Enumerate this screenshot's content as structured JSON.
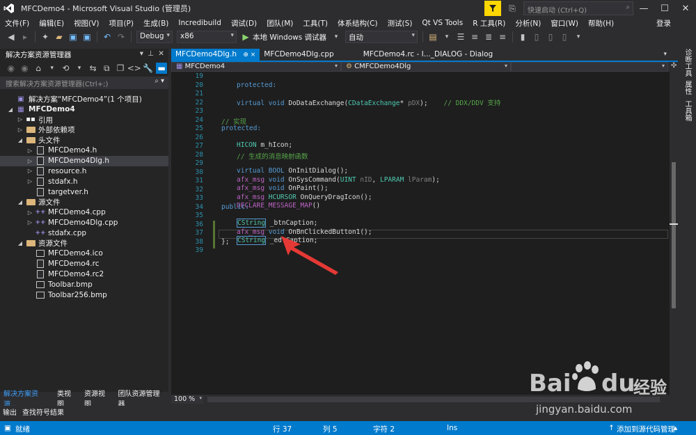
{
  "window": {
    "title": "MFCDemo4 - Microsoft Visual Studio (管理员)",
    "quick_launch_placeholder": "快速启动 (Ctrl+Q)"
  },
  "menu": {
    "items": [
      "文件(F)",
      "编辑(E)",
      "视图(V)",
      "项目(P)",
      "生成(B)",
      "Incredibuild",
      "调试(D)",
      "团队(M)",
      "工具(T)",
      "体系结构(C)",
      "测试(S)",
      "Qt VS Tools",
      "R 工具(R)",
      "分析(N)",
      "窗口(W)",
      "帮助(H)"
    ],
    "login": "登录"
  },
  "toolbar": {
    "config": "Debug",
    "platform": "x86",
    "run_label": "本地 Windows 调试器",
    "run_mode": "自动"
  },
  "solution_explorer": {
    "title": "解决方案资源管理器",
    "search_placeholder": "搜索解决方案资源管理器(Ctrl+;)",
    "tree": [
      {
        "label": "解决方案“MFCDemo4”(1 个项目)",
        "icon": "solution-icon"
      },
      {
        "label": "MFCDemo4",
        "icon": "project-icon"
      },
      {
        "label": "引用",
        "icon": "references-icon"
      },
      {
        "label": "外部依赖项",
        "icon": "external-deps-icon"
      },
      {
        "label": "头文件",
        "icon": "folder-icon"
      },
      {
        "label": "MFCDemo4.h",
        "icon": "header-file-icon"
      },
      {
        "label": "MFCDemo4Dlg.h",
        "icon": "header-file-icon"
      },
      {
        "label": "resource.h",
        "icon": "header-file-icon"
      },
      {
        "label": "stdafx.h",
        "icon": "header-file-icon"
      },
      {
        "label": "targetver.h",
        "icon": "header-file-icon"
      },
      {
        "label": "源文件",
        "icon": "folder-icon"
      },
      {
        "label": "MFCDemo4.cpp",
        "icon": "cpp-file-icon"
      },
      {
        "label": "MFCDemo4Dlg.cpp",
        "icon": "cpp-file-icon"
      },
      {
        "label": "stdafx.cpp",
        "icon": "cpp-file-icon"
      },
      {
        "label": "资源文件",
        "icon": "folder-icon"
      },
      {
        "label": "MFCDemo4.ico",
        "icon": "image-file-icon"
      },
      {
        "label": "MFCDemo4.rc",
        "icon": "resource-file-icon"
      },
      {
        "label": "MFCDemo4.rc2",
        "icon": "resource-file-icon"
      },
      {
        "label": "Toolbar.bmp",
        "icon": "image-file-icon"
      },
      {
        "label": "Toolbar256.bmp",
        "icon": "image-file-icon"
      }
    ],
    "bottom_tabs": [
      "解决方案资源...",
      "类视图",
      "资源视图",
      "团队资源管理器"
    ]
  },
  "editor": {
    "tabs": [
      "MFCDemo4Dlg.h",
      "MFCDemo4Dlg.cpp",
      "MFCDemo4.rc - I..._DIALOG - Dialog"
    ],
    "tab_pin": "⊕ ×",
    "nav_project": "MFCDemo4",
    "nav_class": "CMFCDemo4Dlg",
    "zoom": "100 %",
    "line_numbers": [
      "19",
      "20",
      "21",
      "22",
      "23",
      "24",
      "25",
      "26",
      "27",
      "28",
      "29",
      "30",
      "31",
      "32",
      "33",
      "34",
      "35",
      "36",
      "37",
      "38",
      "39"
    ],
    "code": {
      "l20": "protected:",
      "l21a": "virtual void",
      "l21b": "DoDataExchange(",
      "l21c": "CDataExchange",
      "l21d": "* ",
      "l21e": "pDX",
      "l21f": ");",
      "l21g": "// DDX/DDV 支持",
      "l24": "// 实现",
      "l25": "protected:",
      "l26a": "HICON",
      "l26b": " m_hIcon;",
      "l28": "// 生成的消息映射函数",
      "l29a": "virtual BOOL",
      "l29b": " OnInitDialog();",
      "l30a": "afx_msg",
      "l30b": " void",
      "l30c": " OnSysCommand(",
      "l30d": "UINT",
      "l30e": " nID",
      "l30f": ", ",
      "l30g": "LPARAM",
      "l30h": " lParam",
      "l30i": ");",
      "l31a": "afx_msg",
      "l31b": " void",
      "l31c": " OnPaint();",
      "l32a": "afx_msg",
      "l32b": " HCURSOR",
      "l32c": " OnQueryDragIcon();",
      "l33": "DECLARE_MESSAGE_MAP",
      "l33b": "()",
      "l34": "public:",
      "l35a": "CString",
      "l35b": " _btnCaption;",
      "l36a": "afx_msg",
      "l36b": " void",
      "l36c": " OnBnClickedButton1();",
      "l37a": "CString",
      "l37b": " _edtCaption;",
      "l38": "};"
    }
  },
  "side_tabs": [
    "诊断工具",
    "属性",
    "工具箱"
  ],
  "output_tabs": [
    "输出",
    "查找符号结果"
  ],
  "status": {
    "ready": "就绪",
    "line": "行 37",
    "col": "列 5",
    "char": "字符 2",
    "mode": "Ins",
    "add_source": "添加到源代码管理"
  },
  "watermark": {
    "brand": "Bai",
    "brand2": "du",
    "cn": "经验",
    "url": "jingyan.baidu.com"
  }
}
